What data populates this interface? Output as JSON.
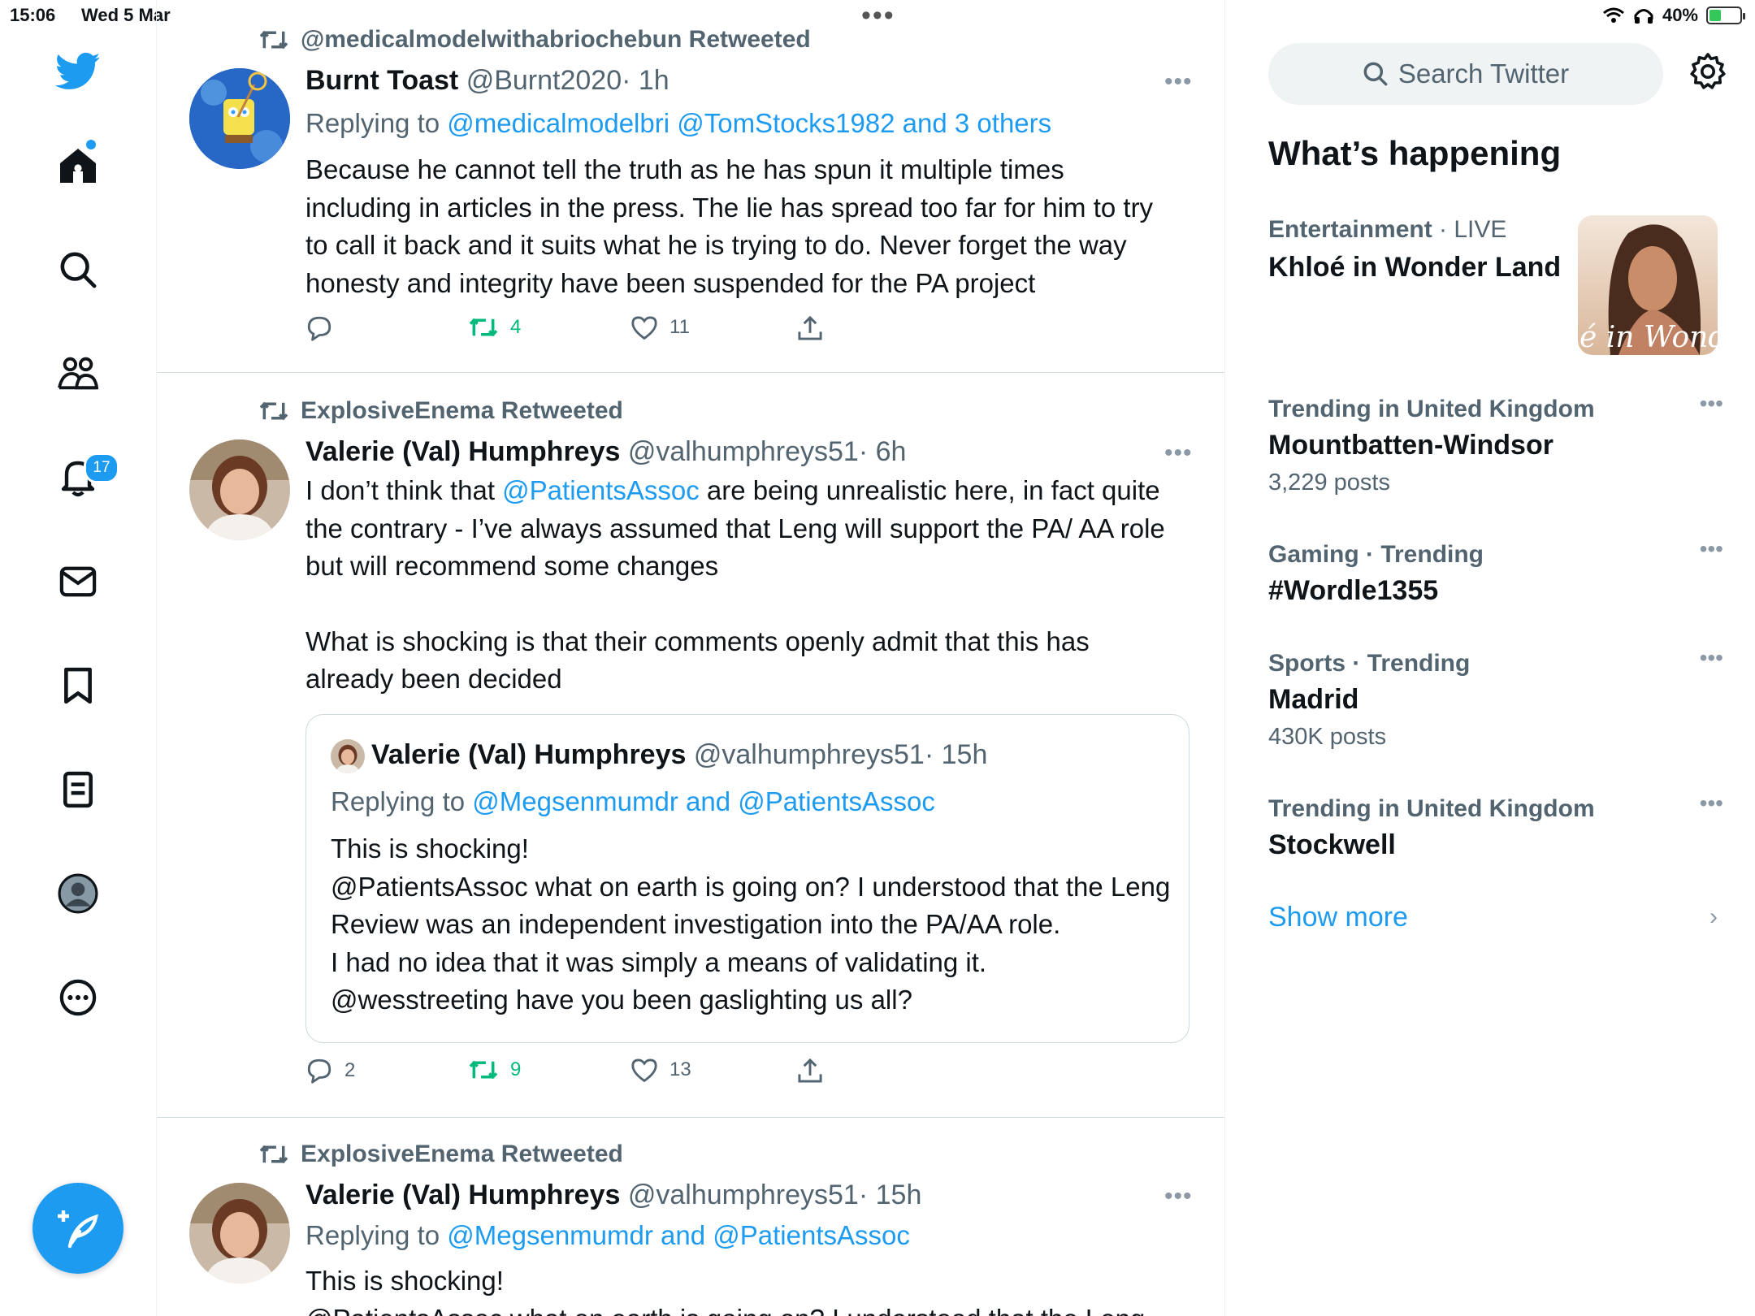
{
  "status_bar": {
    "time": "15:06",
    "date": "Wed 5 Mar",
    "battery": "40%",
    "battery_level": 0.4
  },
  "nav": {
    "notifications_count": "17"
  },
  "tweets": [
    {
      "retweeted_by": "@medicalmodelwithabriochebun Retweeted",
      "name": "Burnt Toast",
      "handle": "@Burnt2020",
      "time": "· 1h",
      "replying_prefix": "Replying to",
      "replying_to": "@medicalmodelbri @TomStocks1982 and 3 others",
      "text": "Because he cannot tell the truth as he has spun it multiple times including in articles in the press. The lie has spread too far for him to try to call it back and it suits what he is trying to do. Never forget the way honesty and integrity have been suspended for the PA project",
      "retweets": "4",
      "likes": "11"
    },
    {
      "retweeted_by": "ExplosiveEnema Retweeted",
      "name": "Valerie (Val) Humphreys",
      "handle": "@valhumphreys51",
      "time": "· 6h",
      "text_pre": "I don’t think that ",
      "text_mention": "@PatientsAssoc",
      "text_post": " are being unrealistic here, in fact quite the contrary - I’ve always assumed that Leng will support the PA/ AA role but will recommend some changes",
      "text_2": "What is shocking is that their comments openly admit that this has already been decided",
      "quote": {
        "name": "Valerie (Val) Humphreys",
        "handle": "@valhumphreys51",
        "time": "· 15h",
        "replying_prefix": "Replying to",
        "replying_to": "@Megsenmumdr and @PatientsAssoc",
        "lines": [
          "This is shocking!",
          "@PatientsAssoc what on earth is going on? I understood that the Leng Review was an independent investigation into the PA/AA role.",
          "I had no idea that it was simply a means of validating it.",
          "@wesstreeting have you been gaslighting us all?"
        ]
      },
      "replies": "2",
      "retweets": "9",
      "likes": "13"
    },
    {
      "retweeted_by": "ExplosiveEnema Retweeted",
      "name": "Valerie (Val) Humphreys",
      "handle": "@valhumphreys51",
      "time": "· 15h",
      "replying_prefix": "Replying to",
      "replying_to": "@Megsenmumdr and @PatientsAssoc",
      "text": "This is shocking!",
      "text_2": "@PatientsAssoc what on earth is going on? I understood that the Leng"
    }
  ],
  "sidebar": {
    "search_placeholder": "Search Twitter",
    "heading": "What’s happening",
    "featured": {
      "category": "Entertainment",
      "live": "· LIVE",
      "title": "Khloé in Wonder Land",
      "image_text": "é in Wonder L"
    },
    "trends": [
      {
        "meta": "Trending in United Kingdom",
        "topic": "Mountbatten-Windsor",
        "count": "3,229 posts"
      },
      {
        "meta": "Gaming · Trending",
        "topic": "#Wordle1355",
        "count": ""
      },
      {
        "meta": "Sports · Trending",
        "topic": "Madrid",
        "count": "430K posts"
      },
      {
        "meta": "Trending in United Kingdom",
        "topic": "Stockwell",
        "count": ""
      }
    ],
    "show_more": "Show more"
  },
  "colors": {
    "accent": "#1d9bf0",
    "retweet_green": "#00ba7c",
    "secondary_text": "#536471"
  }
}
